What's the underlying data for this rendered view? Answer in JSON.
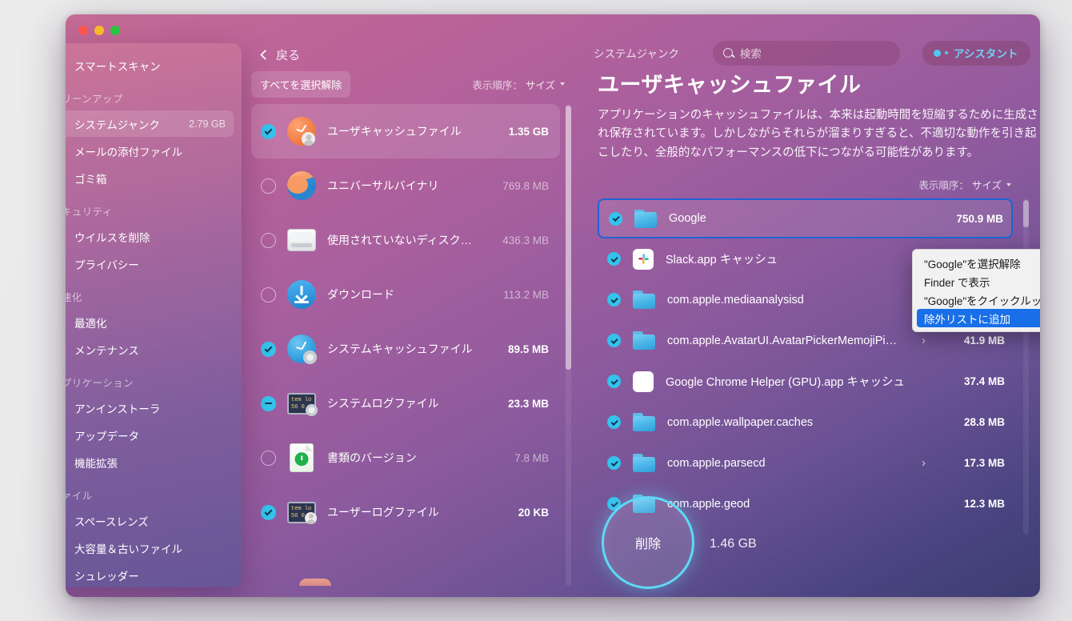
{
  "window": {
    "traffic_lights": [
      "close",
      "minimize",
      "zoom"
    ],
    "back_label": "戻る",
    "breadcrumb": "システムジャンク"
  },
  "search": {
    "placeholder": "検索",
    "icon": "search-icon"
  },
  "assistant": {
    "label": "アシスタント",
    "accent": "#6fd2f5"
  },
  "sidebar": {
    "items": [
      {
        "type": "item",
        "label": "スマートスキャン",
        "icon": "monitor-scan-icon",
        "size": "",
        "active": false
      },
      {
        "type": "group",
        "label": "クリーンアップ"
      },
      {
        "type": "item",
        "label": "システムジャンク",
        "icon": "junk-icon",
        "size": "2.79 GB",
        "active": true
      },
      {
        "type": "item",
        "label": "メールの添付ファイル",
        "icon": "mail-icon",
        "size": "",
        "active": false
      },
      {
        "type": "item",
        "label": "ゴミ箱",
        "icon": "trash-icon",
        "size": "",
        "active": false
      },
      {
        "type": "group",
        "label": "セキュリティ"
      },
      {
        "type": "item",
        "label": "ウイルスを削除",
        "icon": "biohazard-icon",
        "size": "",
        "active": false
      },
      {
        "type": "item",
        "label": "プライバシー",
        "icon": "hand-icon",
        "size": "",
        "active": false
      },
      {
        "type": "group",
        "label": "高速化"
      },
      {
        "type": "item",
        "label": "最適化",
        "icon": "sliders-icon",
        "size": "",
        "active": false
      },
      {
        "type": "item",
        "label": "メンテナンス",
        "icon": "wrench-icon",
        "size": "",
        "active": false
      },
      {
        "type": "group",
        "label": "アプリケーション"
      },
      {
        "type": "item",
        "label": "アンインストーラ",
        "icon": "uninstaller-icon",
        "size": "",
        "active": false
      },
      {
        "type": "item",
        "label": "アップデータ",
        "icon": "updater-icon",
        "size": "",
        "active": false
      },
      {
        "type": "item",
        "label": "機能拡張",
        "icon": "extensions-icon",
        "size": "",
        "active": false
      },
      {
        "type": "group",
        "label": "ファイル"
      },
      {
        "type": "item",
        "label": "スペースレンズ",
        "icon": "space-lens-icon",
        "size": "",
        "active": false
      },
      {
        "type": "item",
        "label": "大容量＆古いファイル",
        "icon": "large-old-files-icon",
        "size": "",
        "active": false
      },
      {
        "type": "item",
        "label": "シュレッダー",
        "icon": "shredder-icon",
        "size": "",
        "active": false
      }
    ]
  },
  "mid_panel": {
    "deselect_all_label": "すべてを選択解除",
    "sort_label": "表示順序：",
    "sort_value": "サイズ",
    "rows": [
      {
        "name": "ユーザキャッシュファイル",
        "size": "1.35 GB",
        "check": "on",
        "selected": true,
        "icon": "user-cache-icon",
        "dim": false
      },
      {
        "name": "ユニバーサルバイナリ",
        "size": "769.8 MB",
        "check": "off",
        "selected": false,
        "icon": "universal-binary-icon",
        "dim": true
      },
      {
        "name": "使用されていないディスク…",
        "size": "436.3 MB",
        "check": "off",
        "selected": false,
        "icon": "disk-image-icon",
        "dim": true
      },
      {
        "name": "ダウンロード",
        "size": "113.2 MB",
        "check": "off",
        "selected": false,
        "icon": "download-icon",
        "dim": true
      },
      {
        "name": "システムキャッシュファイル",
        "size": "89.5 MB",
        "check": "on",
        "selected": false,
        "icon": "system-cache-icon",
        "dim": false
      },
      {
        "name": "システムログファイル",
        "size": "23.3 MB",
        "check": "partial",
        "selected": false,
        "icon": "system-log-icon",
        "dim": false
      },
      {
        "name": "書類のバージョン",
        "size": "7.8 MB",
        "check": "off",
        "selected": false,
        "icon": "document-version-icon",
        "dim": true
      },
      {
        "name": "ユーザーログファイル",
        "size": "20 KB",
        "check": "on",
        "selected": false,
        "icon": "user-log-icon",
        "dim": false
      }
    ]
  },
  "right_panel": {
    "title": "ユーザキャッシュファイル",
    "description": "アプリケーションのキャッシュファイルは、本来は起動時間を短縮するために生成され保存されています。しかしながらそれらが溜まりすぎると、不適切な動作を引き起こしたり、全般的なパフォーマンスの低下につながる可能性があります。",
    "sort_label": "表示順序：",
    "sort_value": "サイズ",
    "rows": [
      {
        "name": "Google",
        "size": "750.9 MB",
        "check": "on",
        "icon": "folder-icon",
        "arrow": false,
        "highlight": true
      },
      {
        "name": "Slack.app キャッシュ",
        "size": "",
        "check": "on",
        "icon": "slack-app-icon",
        "arrow": false,
        "highlight": false
      },
      {
        "name": "com.apple.mediaanalysisd",
        "size": "",
        "check": "on",
        "icon": "folder-icon",
        "arrow": false,
        "highlight": false
      },
      {
        "name": "com.apple.AvatarUI.AvatarPickerMemojiPi…",
        "size": "41.9 MB",
        "check": "on",
        "icon": "folder-icon",
        "arrow": true,
        "highlight": false
      },
      {
        "name": "Google Chrome Helper (GPU).app キャッシュ",
        "size": "37.4 MB",
        "check": "on",
        "icon": "blank-app-icon",
        "arrow": false,
        "highlight": false
      },
      {
        "name": "com.apple.wallpaper.caches",
        "size": "28.8 MB",
        "check": "on",
        "icon": "folder-icon",
        "arrow": false,
        "highlight": false
      },
      {
        "name": "com.apple.parsecd",
        "size": "17.3 MB",
        "check": "on",
        "icon": "folder-icon",
        "arrow": true,
        "highlight": false
      },
      {
        "name": "com.apple.geod",
        "size": "12.3 MB",
        "check": "on",
        "icon": "folder-icon",
        "arrow": false,
        "highlight": false
      }
    ]
  },
  "context_menu": {
    "items": [
      {
        "label": "\"Google\"を選択解除",
        "selected": false
      },
      {
        "label": "Finder で表示",
        "selected": false
      },
      {
        "label": "\"Google\"をクイックルック",
        "selected": false
      },
      {
        "label": "除外リストに追加",
        "selected": true
      }
    ]
  },
  "footer": {
    "delete_label": "削除",
    "total_size": "1.46 GB",
    "accent": "#5fd8f5"
  }
}
